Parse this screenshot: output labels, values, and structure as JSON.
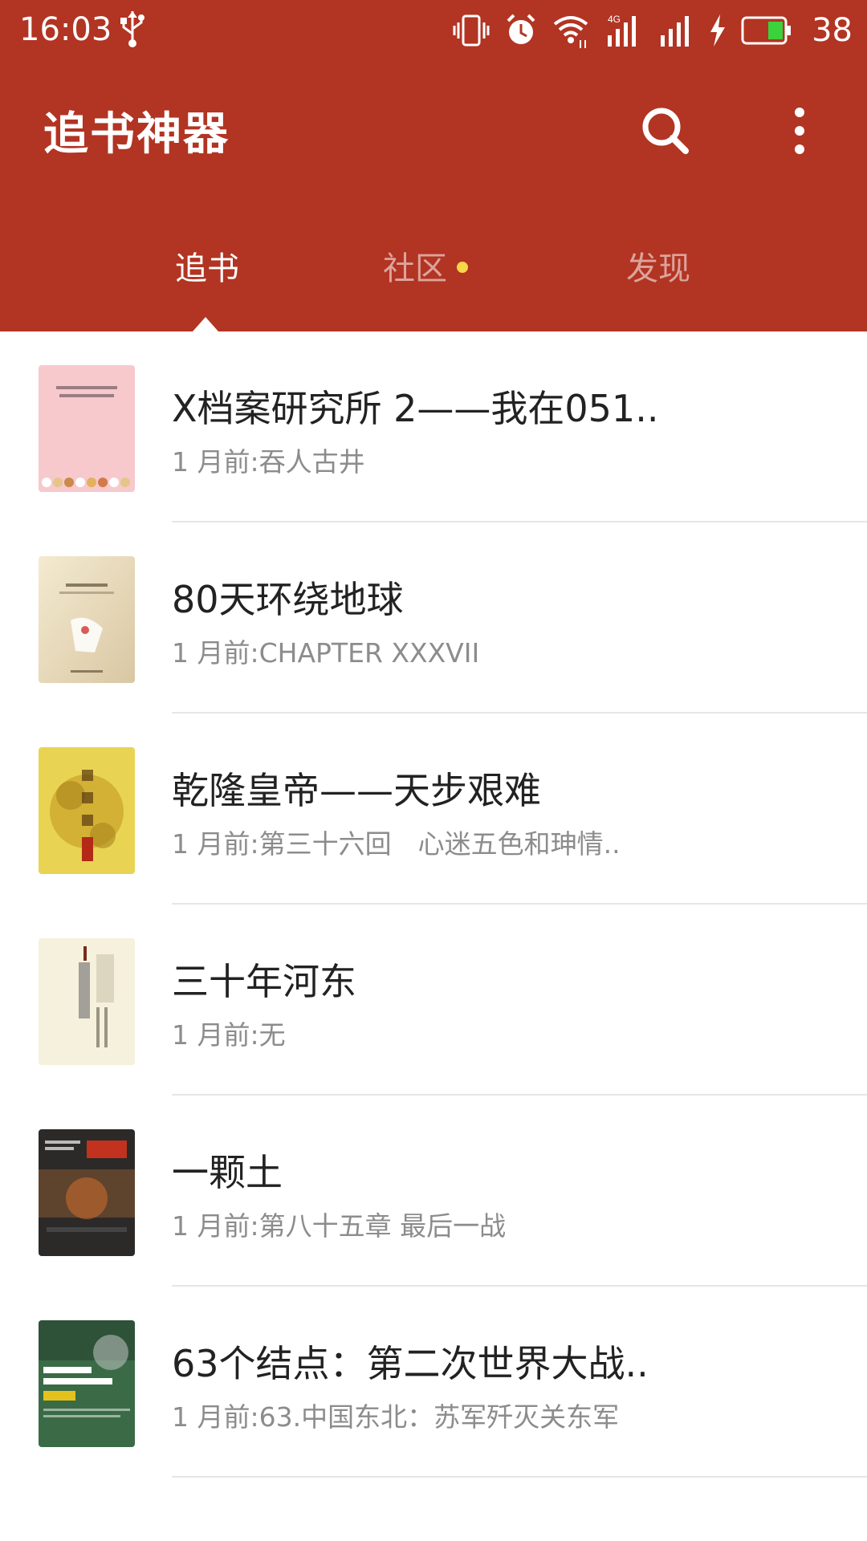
{
  "status_bar": {
    "time": "16:03",
    "network": "4G",
    "battery": "38",
    "icons": [
      "usb-icon",
      "vibrate-icon",
      "alarm-icon",
      "wifi-icon",
      "signal-icon",
      "charging-icon",
      "battery-icon"
    ]
  },
  "toolbar": {
    "title": "追书神器",
    "search_icon": "search-icon",
    "more_icon": "more-vert-icon"
  },
  "tabs": [
    {
      "label": "追书",
      "active": true
    },
    {
      "label": "社区",
      "active": false,
      "has_dot": true
    },
    {
      "label": "发现",
      "active": false
    }
  ],
  "books": [
    {
      "title": "X档案研究所 2——我在051..",
      "subtitle": "1 月前:吞人古井"
    },
    {
      "title": "80天环绕地球",
      "subtitle": "1 月前:CHAPTER XXXVII"
    },
    {
      "title": "乾隆皇帝——天步艰难",
      "subtitle": "1 月前:第三十六回　心迷五色和珅情.."
    },
    {
      "title": "三十年河东",
      "subtitle": "1 月前:无"
    },
    {
      "title": "一颗土",
      "subtitle": "1 月前:第八十五章 最后一战"
    },
    {
      "title": "63个结点：第二次世界大战..",
      "subtitle": "1 月前:63.中国东北：苏军歼灭关东军"
    }
  ],
  "colors": {
    "header": "#b23422",
    "tab_dot": "#f7d64a",
    "title_text": "#222222",
    "subtitle_text": "#8c8c8c"
  }
}
